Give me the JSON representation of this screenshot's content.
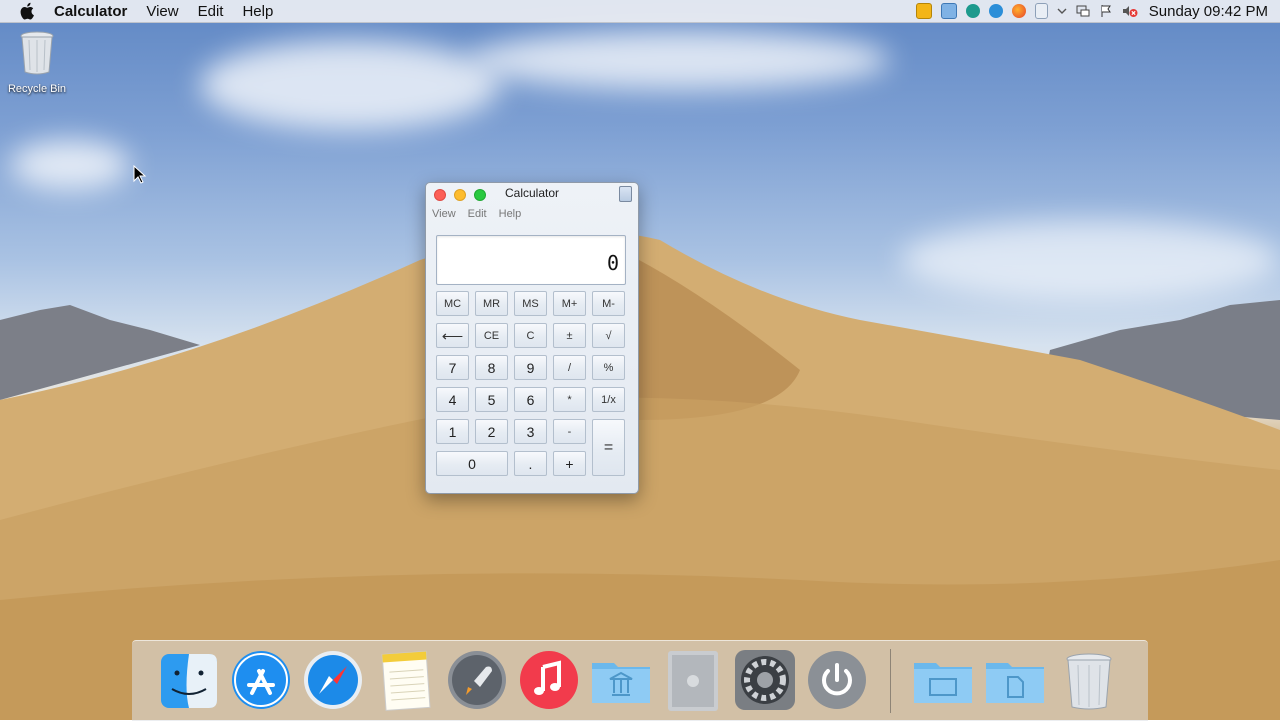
{
  "menubar": {
    "apple_icon": "apple-logo-icon",
    "app_name": "Calculator",
    "items": [
      "View",
      "Edit",
      "Help"
    ],
    "tray_icons": [
      "media-player-icon",
      "file-manager-icon",
      "chat-icon",
      "browser-e-icon",
      "firefox-icon",
      "clipboard-icon",
      "chevron-down-icon",
      "network-icon",
      "flag-icon",
      "volume-muted-icon"
    ],
    "clock": "Sunday 09:42 PM"
  },
  "desktop": {
    "recycle_bin_label": "Recycle Bin"
  },
  "calculator": {
    "title": "Calculator",
    "menus": [
      "View",
      "Edit",
      "Help"
    ],
    "display": "0",
    "memory_row": [
      "MC",
      "MR",
      "MS",
      "M+",
      "M-"
    ],
    "row2": [
      "⟵",
      "CE",
      "C",
      "±",
      "√"
    ],
    "row3": [
      "7",
      "8",
      "9",
      "/",
      "%"
    ],
    "row4": [
      "4",
      "5",
      "6",
      "*",
      "1/x"
    ],
    "row5": [
      "1",
      "2",
      "3",
      "-"
    ],
    "row6": [
      "0",
      ".",
      "+"
    ],
    "equals": "="
  },
  "dock": {
    "items": [
      "finder-icon",
      "app-store-icon",
      "safari-icon",
      "notes-icon",
      "launchpad-icon",
      "music-icon",
      "applications-folder-icon",
      "mac-pro-icon",
      "system-preferences-icon",
      "power-icon",
      "desktop-folder-icon",
      "documents-folder-icon",
      "trash-icon"
    ]
  },
  "colors": {
    "close": "#fc5f57",
    "minimize": "#fdbc2e",
    "maximize": "#29c940"
  }
}
